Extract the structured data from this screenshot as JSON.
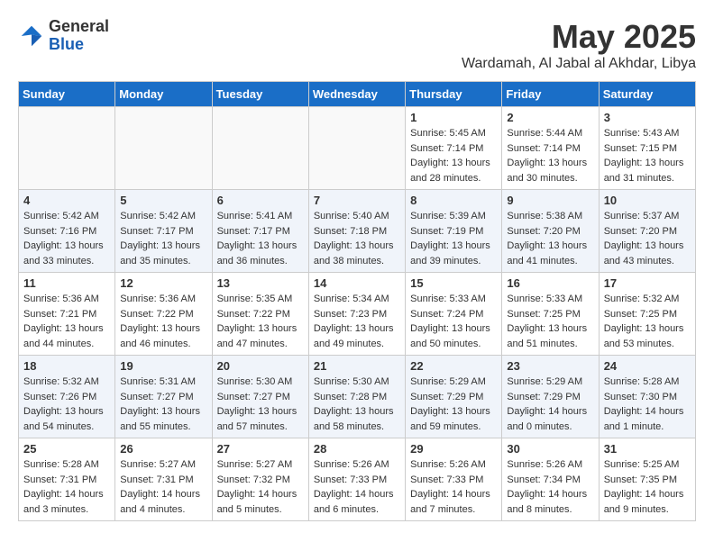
{
  "header": {
    "logo_general": "General",
    "logo_blue": "Blue",
    "month": "May 2025",
    "location": "Wardamah, Al Jabal al Akhdar, Libya"
  },
  "days_of_week": [
    "Sunday",
    "Monday",
    "Tuesday",
    "Wednesday",
    "Thursday",
    "Friday",
    "Saturday"
  ],
  "weeks": [
    [
      {
        "day": "",
        "info": ""
      },
      {
        "day": "",
        "info": ""
      },
      {
        "day": "",
        "info": ""
      },
      {
        "day": "",
        "info": ""
      },
      {
        "day": "1",
        "info": "Sunrise: 5:45 AM\nSunset: 7:14 PM\nDaylight: 13 hours\nand 28 minutes."
      },
      {
        "day": "2",
        "info": "Sunrise: 5:44 AM\nSunset: 7:14 PM\nDaylight: 13 hours\nand 30 minutes."
      },
      {
        "day": "3",
        "info": "Sunrise: 5:43 AM\nSunset: 7:15 PM\nDaylight: 13 hours\nand 31 minutes."
      }
    ],
    [
      {
        "day": "4",
        "info": "Sunrise: 5:42 AM\nSunset: 7:16 PM\nDaylight: 13 hours\nand 33 minutes."
      },
      {
        "day": "5",
        "info": "Sunrise: 5:42 AM\nSunset: 7:17 PM\nDaylight: 13 hours\nand 35 minutes."
      },
      {
        "day": "6",
        "info": "Sunrise: 5:41 AM\nSunset: 7:17 PM\nDaylight: 13 hours\nand 36 minutes."
      },
      {
        "day": "7",
        "info": "Sunrise: 5:40 AM\nSunset: 7:18 PM\nDaylight: 13 hours\nand 38 minutes."
      },
      {
        "day": "8",
        "info": "Sunrise: 5:39 AM\nSunset: 7:19 PM\nDaylight: 13 hours\nand 39 minutes."
      },
      {
        "day": "9",
        "info": "Sunrise: 5:38 AM\nSunset: 7:20 PM\nDaylight: 13 hours\nand 41 minutes."
      },
      {
        "day": "10",
        "info": "Sunrise: 5:37 AM\nSunset: 7:20 PM\nDaylight: 13 hours\nand 43 minutes."
      }
    ],
    [
      {
        "day": "11",
        "info": "Sunrise: 5:36 AM\nSunset: 7:21 PM\nDaylight: 13 hours\nand 44 minutes."
      },
      {
        "day": "12",
        "info": "Sunrise: 5:36 AM\nSunset: 7:22 PM\nDaylight: 13 hours\nand 46 minutes."
      },
      {
        "day": "13",
        "info": "Sunrise: 5:35 AM\nSunset: 7:22 PM\nDaylight: 13 hours\nand 47 minutes."
      },
      {
        "day": "14",
        "info": "Sunrise: 5:34 AM\nSunset: 7:23 PM\nDaylight: 13 hours\nand 49 minutes."
      },
      {
        "day": "15",
        "info": "Sunrise: 5:33 AM\nSunset: 7:24 PM\nDaylight: 13 hours\nand 50 minutes."
      },
      {
        "day": "16",
        "info": "Sunrise: 5:33 AM\nSunset: 7:25 PM\nDaylight: 13 hours\nand 51 minutes."
      },
      {
        "day": "17",
        "info": "Sunrise: 5:32 AM\nSunset: 7:25 PM\nDaylight: 13 hours\nand 53 minutes."
      }
    ],
    [
      {
        "day": "18",
        "info": "Sunrise: 5:32 AM\nSunset: 7:26 PM\nDaylight: 13 hours\nand 54 minutes."
      },
      {
        "day": "19",
        "info": "Sunrise: 5:31 AM\nSunset: 7:27 PM\nDaylight: 13 hours\nand 55 minutes."
      },
      {
        "day": "20",
        "info": "Sunrise: 5:30 AM\nSunset: 7:27 PM\nDaylight: 13 hours\nand 57 minutes."
      },
      {
        "day": "21",
        "info": "Sunrise: 5:30 AM\nSunset: 7:28 PM\nDaylight: 13 hours\nand 58 minutes."
      },
      {
        "day": "22",
        "info": "Sunrise: 5:29 AM\nSunset: 7:29 PM\nDaylight: 13 hours\nand 59 minutes."
      },
      {
        "day": "23",
        "info": "Sunrise: 5:29 AM\nSunset: 7:29 PM\nDaylight: 14 hours\nand 0 minutes."
      },
      {
        "day": "24",
        "info": "Sunrise: 5:28 AM\nSunset: 7:30 PM\nDaylight: 14 hours\nand 1 minute."
      }
    ],
    [
      {
        "day": "25",
        "info": "Sunrise: 5:28 AM\nSunset: 7:31 PM\nDaylight: 14 hours\nand 3 minutes."
      },
      {
        "day": "26",
        "info": "Sunrise: 5:27 AM\nSunset: 7:31 PM\nDaylight: 14 hours\nand 4 minutes."
      },
      {
        "day": "27",
        "info": "Sunrise: 5:27 AM\nSunset: 7:32 PM\nDaylight: 14 hours\nand 5 minutes."
      },
      {
        "day": "28",
        "info": "Sunrise: 5:26 AM\nSunset: 7:33 PM\nDaylight: 14 hours\nand 6 minutes."
      },
      {
        "day": "29",
        "info": "Sunrise: 5:26 AM\nSunset: 7:33 PM\nDaylight: 14 hours\nand 7 minutes."
      },
      {
        "day": "30",
        "info": "Sunrise: 5:26 AM\nSunset: 7:34 PM\nDaylight: 14 hours\nand 8 minutes."
      },
      {
        "day": "31",
        "info": "Sunrise: 5:25 AM\nSunset: 7:35 PM\nDaylight: 14 hours\nand 9 minutes."
      }
    ]
  ]
}
